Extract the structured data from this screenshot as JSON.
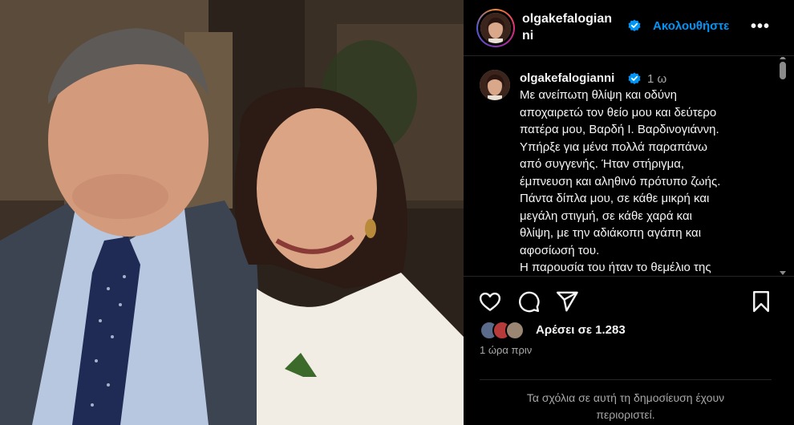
{
  "post": {
    "photo_alt": "photo"
  },
  "header": {
    "username": "olgakefalogianni",
    "follow_label": "Ακολουθήστε",
    "more_label": "•••"
  },
  "caption": {
    "username": "olgakefalogianni",
    "time": "1 ω",
    "lines": [
      "Με ανείπωτη θλίψη και οδύνη",
      "αποχαιρετώ τον θείο μου και δεύτερο",
      "πατέρα μου, Βαρδή Ι. Βαρδινογιάννη.",
      "Υπήρξε για μένα πολλά παραπάνω",
      "από συγγενής. Ήταν στήριγμα,",
      "έμπνευση και αληθινό πρότυπο ζωής.",
      "Πάντα δίπλα μου, σε κάθε μικρή και",
      "μεγάλη στιγμή, σε κάθε χαρά και",
      "θλίψη, με την αδιάκοπη αγάπη και",
      "αφοσίωσή του.",
      "Η παρουσία του ήταν το θεμέλιο της"
    ]
  },
  "actions": {
    "like_icon": "heart-icon",
    "comment_icon": "comment-icon",
    "share_icon": "share-icon",
    "save_icon": "bookmark-icon"
  },
  "likes": {
    "text": "Αρέσει σε 1.283"
  },
  "timestamp": "1 ώρα πριν",
  "comments": {
    "restricted_line1": "Τα σχόλια σε αυτή τη δημοσίευση έχουν",
    "restricted_line2": "περιοριστεί."
  },
  "colors": {
    "accent": "#0095f6",
    "background": "#000000",
    "secondary_text": "#a8a8a8"
  }
}
